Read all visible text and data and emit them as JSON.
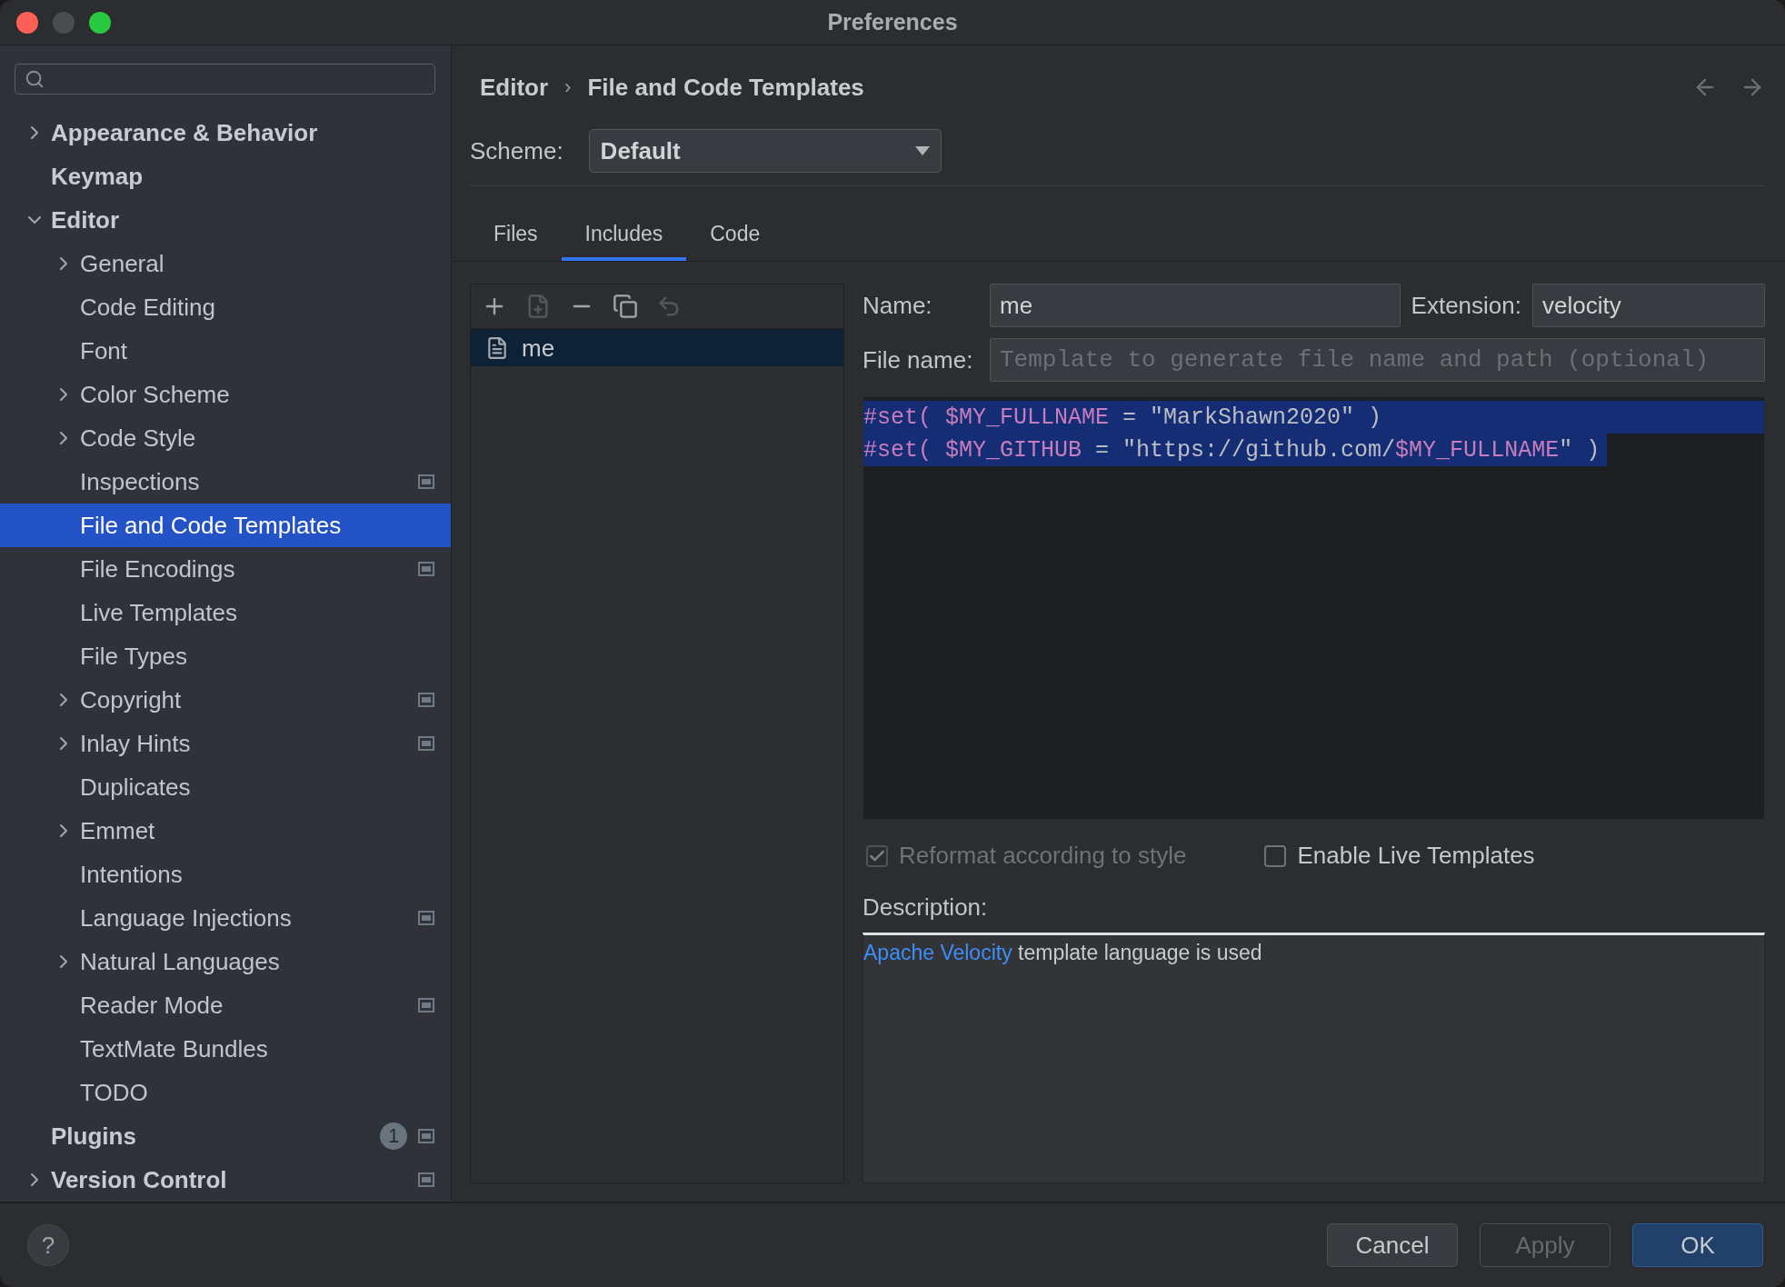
{
  "window": {
    "title": "Preferences"
  },
  "sidebar": {
    "items": [
      {
        "label": "Appearance & Behavior",
        "expanded": false,
        "selected": false
      },
      {
        "label": "Keymap",
        "selected": false
      },
      {
        "label": "Editor",
        "expanded": true,
        "selected": false,
        "children": [
          {
            "label": "General",
            "expanded": false,
            "selected": false
          },
          {
            "label": "Code Editing",
            "selected": false
          },
          {
            "label": "Font",
            "selected": false
          },
          {
            "label": "Color Scheme",
            "expanded": false,
            "selected": false
          },
          {
            "label": "Code Style",
            "expanded": false,
            "selected": false
          },
          {
            "label": "Inspections",
            "project_level": true,
            "selected": false
          },
          {
            "label": "File and Code Templates",
            "selected": true
          },
          {
            "label": "File Encodings",
            "project_level": true,
            "selected": false
          },
          {
            "label": "Live Templates",
            "selected": false
          },
          {
            "label": "File Types",
            "selected": false
          },
          {
            "label": "Copyright",
            "expanded": false,
            "project_level": true,
            "selected": false
          },
          {
            "label": "Inlay Hints",
            "expanded": false,
            "project_level": true,
            "selected": false
          },
          {
            "label": "Duplicates",
            "selected": false
          },
          {
            "label": "Emmet",
            "expanded": false,
            "selected": false
          },
          {
            "label": "Intentions",
            "selected": false
          },
          {
            "label": "Language Injections",
            "project_level": true,
            "selected": false
          },
          {
            "label": "Natural Languages",
            "expanded": false,
            "selected": false
          },
          {
            "label": "Reader Mode",
            "project_level": true,
            "selected": false
          },
          {
            "label": "TextMate Bundles",
            "selected": false
          },
          {
            "label": "TODO",
            "selected": false
          }
        ]
      },
      {
        "label": "Plugins",
        "badge": "1",
        "project_level": true,
        "selected": false
      },
      {
        "label": "Version Control",
        "expanded": false,
        "project_level": true,
        "selected": false
      }
    ]
  },
  "breadcrumb": [
    "Editor",
    "File and Code Templates"
  ],
  "breadcrumb_separator": "›",
  "help": {
    "label": "?"
  },
  "scheme": {
    "label": "Scheme:",
    "value": "Default"
  },
  "tabs": [
    {
      "label": "Files",
      "selected": false
    },
    {
      "label": "Includes",
      "selected": true
    },
    {
      "label": "Code",
      "selected": false
    }
  ],
  "toolbar": [
    {
      "kind": "add",
      "disabled": false
    },
    {
      "kind": "add-file",
      "disabled": true
    },
    {
      "kind": "remove",
      "disabled": false
    },
    {
      "kind": "copy",
      "disabled": false
    },
    {
      "kind": "reset",
      "disabled": true
    }
  ],
  "templates": [
    {
      "name": "me",
      "selected": true
    }
  ],
  "form": {
    "name_label": "Name:",
    "name": "me",
    "extension_label": "Extension:",
    "extension": "velocity",
    "file_name_label": "File name:",
    "file_name_placeholder": "Template to generate file name and path (optional)"
  },
  "editor": {
    "lines": [
      {
        "selected": true,
        "segments": [
          {
            "kind": "directive",
            "text": "#set( "
          },
          {
            "kind": "variable",
            "text": "$MY_FULLNAME"
          },
          {
            "kind": "plain",
            "text": " = \"MarkShawn2020\" )"
          }
        ]
      },
      {
        "selected": true,
        "segments": [
          {
            "kind": "directive",
            "text": "#set( "
          },
          {
            "kind": "variable",
            "text": "$MY_GITHUB"
          },
          {
            "kind": "plain",
            "text": " = \"https://github.com/"
          },
          {
            "kind": "variable",
            "text": "$MY_FULLNAME"
          },
          {
            "kind": "plain",
            "text": "\" )"
          }
        ]
      }
    ]
  },
  "options": [
    {
      "label": "Reformat according to style",
      "checked": true,
      "disabled": true
    },
    {
      "label": "Enable Live Templates",
      "checked": false,
      "disabled": false
    }
  ],
  "description": {
    "label": "Description:",
    "link": "Apache Velocity",
    "text": "template language is used"
  },
  "buttons": [
    {
      "label": "Cancel",
      "disabled": false,
      "primary": false
    },
    {
      "label": "Apply",
      "disabled": true,
      "primary": false
    },
    {
      "label": "OK",
      "disabled": false,
      "primary": true
    }
  ]
}
